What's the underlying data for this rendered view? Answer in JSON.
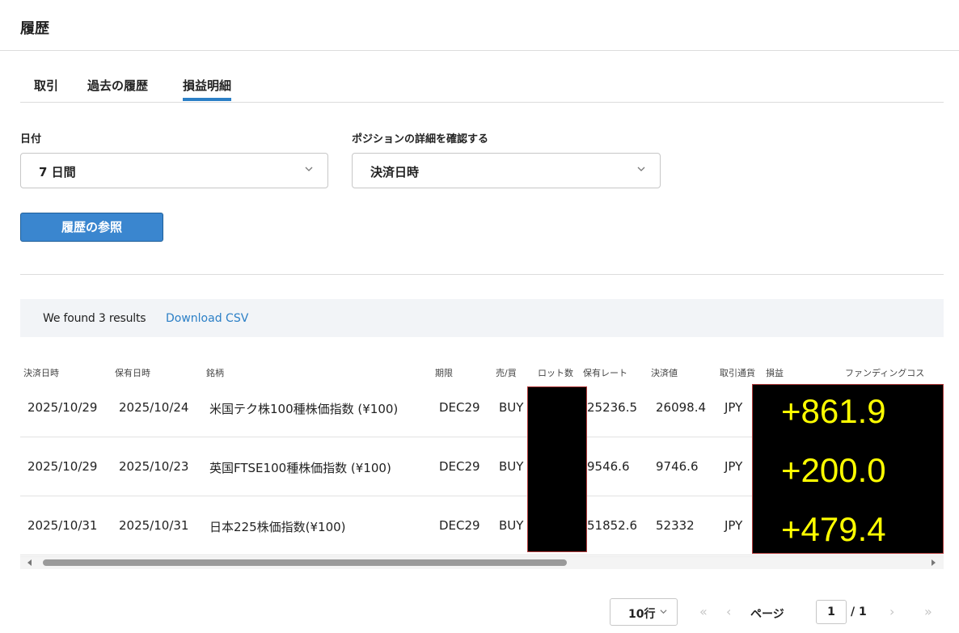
{
  "page": {
    "title": "履歴"
  },
  "tabs": [
    {
      "label": "取引"
    },
    {
      "label": "過去の履歴"
    },
    {
      "label": "損益明細",
      "active": true
    }
  ],
  "filters": {
    "date_label": "日付",
    "date_value": "7 日間",
    "position_label": "ポジションの詳細を確認する",
    "position_value": "決済日時"
  },
  "submit_label": "履歴の参照",
  "results": {
    "summary": "We found 3 results",
    "download_label": "Download CSV"
  },
  "table": {
    "headers": [
      "決済日時",
      "保有日時",
      "銘柄",
      "期限",
      "売/買",
      "ロット数",
      "保有レート",
      "決済値",
      "取引通貨",
      "損益",
      "ファンディングコス"
    ],
    "rows": [
      {
        "close_date": "2025/10/29",
        "open_date": "2025/10/24",
        "symbol": "米国テク株100種株価指数 (¥100)",
        "expiry": "DEC29",
        "side": "BUY",
        "open_rate": "25236.5",
        "close_price": "26098.4",
        "currency": "JPY",
        "pnl": "+861.9"
      },
      {
        "close_date": "2025/10/29",
        "open_date": "2025/10/23",
        "symbol": "英国FTSE100種株価指数 (¥100)",
        "expiry": "DEC29",
        "side": "BUY",
        "open_rate": "9546.6",
        "close_price": "9746.6",
        "currency": "JPY",
        "pnl": "+200.0"
      },
      {
        "close_date": "2025/10/31",
        "open_date": "2025/10/31",
        "symbol": "日本225株価指数(¥100)",
        "expiry": "DEC29",
        "side": "BUY",
        "open_rate": "51852.6",
        "close_price": "52332",
        "currency": "JPY",
        "pnl": "+479.4"
      }
    ]
  },
  "pagination": {
    "rows_per_page": "10行",
    "page_label": "ページ",
    "current_page": "1",
    "total_pages": "/ 1",
    "first_icon": "«",
    "prev_icon": "‹",
    "next_icon": "›",
    "last_icon": "»"
  },
  "colors": {
    "accent": "#2b7fc6",
    "button": "#3a86cf",
    "redaction": "#000000",
    "pnl_text": "#ffff00"
  }
}
